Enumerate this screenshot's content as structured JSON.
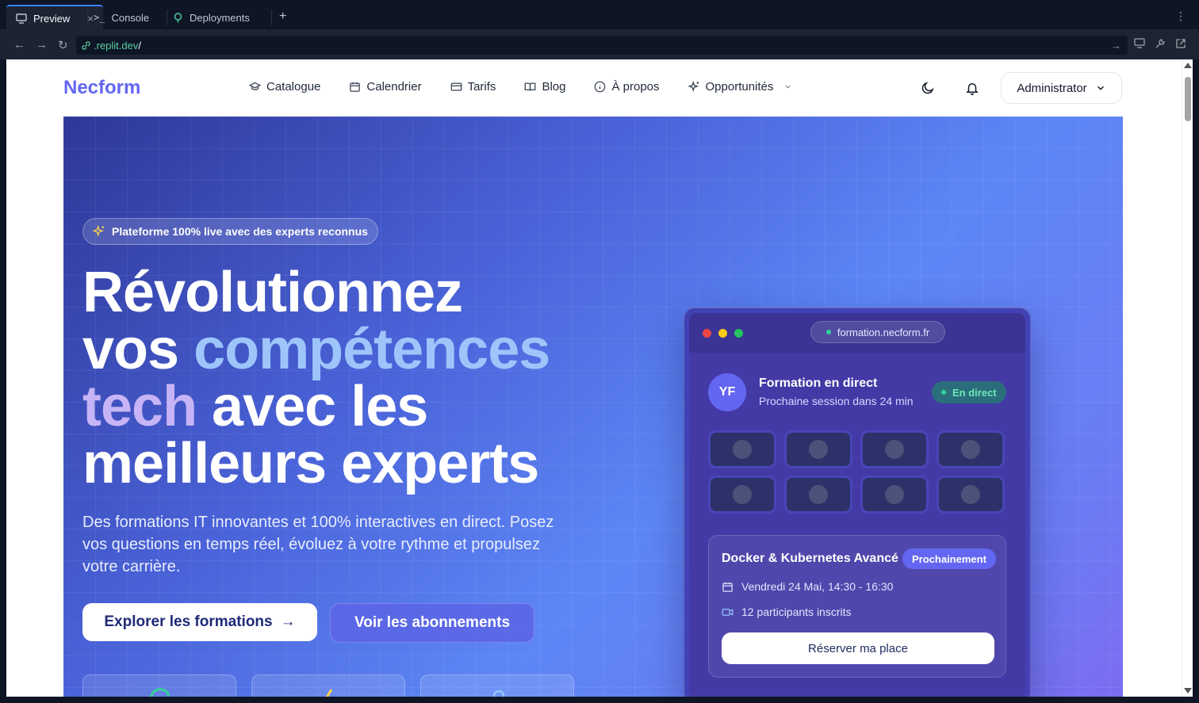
{
  "ide": {
    "tabs": [
      {
        "label": "Preview",
        "icon": "monitor-icon"
      },
      {
        "label": "Console",
        "icon": "terminal-icon"
      },
      {
        "label": "Deployments",
        "icon": "deploy-icon"
      }
    ],
    "close_glyph": "×",
    "add_glyph": "+",
    "more_glyph": "⋮"
  },
  "browser": {
    "url_host": ".replit.dev",
    "url_path": "/"
  },
  "site": {
    "logo": "Necform",
    "nav": [
      {
        "label": "Catalogue",
        "icon": "graduation-cap-icon"
      },
      {
        "label": "Calendrier",
        "icon": "calendar-icon"
      },
      {
        "label": "Tarifs",
        "icon": "credit-card-icon"
      },
      {
        "label": "Blog",
        "icon": "book-open-icon"
      },
      {
        "label": "À propos",
        "icon": "info-icon"
      },
      {
        "label": "Opportunités",
        "icon": "sparkles-icon"
      }
    ],
    "user_menu": "Administrator"
  },
  "hero": {
    "pill": "Plateforme 100% live avec des experts reconnus",
    "h1_a": "Révolutionnez",
    "h1_b": "vos ",
    "h1_c": "compétences",
    "h1_d": "tech",
    "h1_e": " avec les",
    "h1_f": "meilleurs experts",
    "lead": "Des formations IT innovantes et 100% interactives en direct. Posez vos questions en temps réel, évoluez à votre rythme et propulsez votre carrière.",
    "cta_primary": "Explorer les formations",
    "cta_primary_arrow": "→",
    "cta_secondary": "Voir les abonnements"
  },
  "mockup": {
    "url": "formation.necform.fr",
    "avatar_initials": "YF",
    "live_title": "Formation en direct",
    "live_subtitle": "Prochaine session dans 24 min",
    "live_badge": "En direct",
    "session_title": "Docker & Kubernetes Avancé",
    "session_badge": "Prochainement",
    "session_date": "Vendredi 24 Mai, 14:30 - 16:30",
    "session_participants": "12 participants inscrits",
    "reserve_button": "Réserver ma place"
  },
  "colors": {
    "brand": "#6366f1",
    "live_green": "#34d399",
    "accent_blue": "#3b82f6"
  }
}
